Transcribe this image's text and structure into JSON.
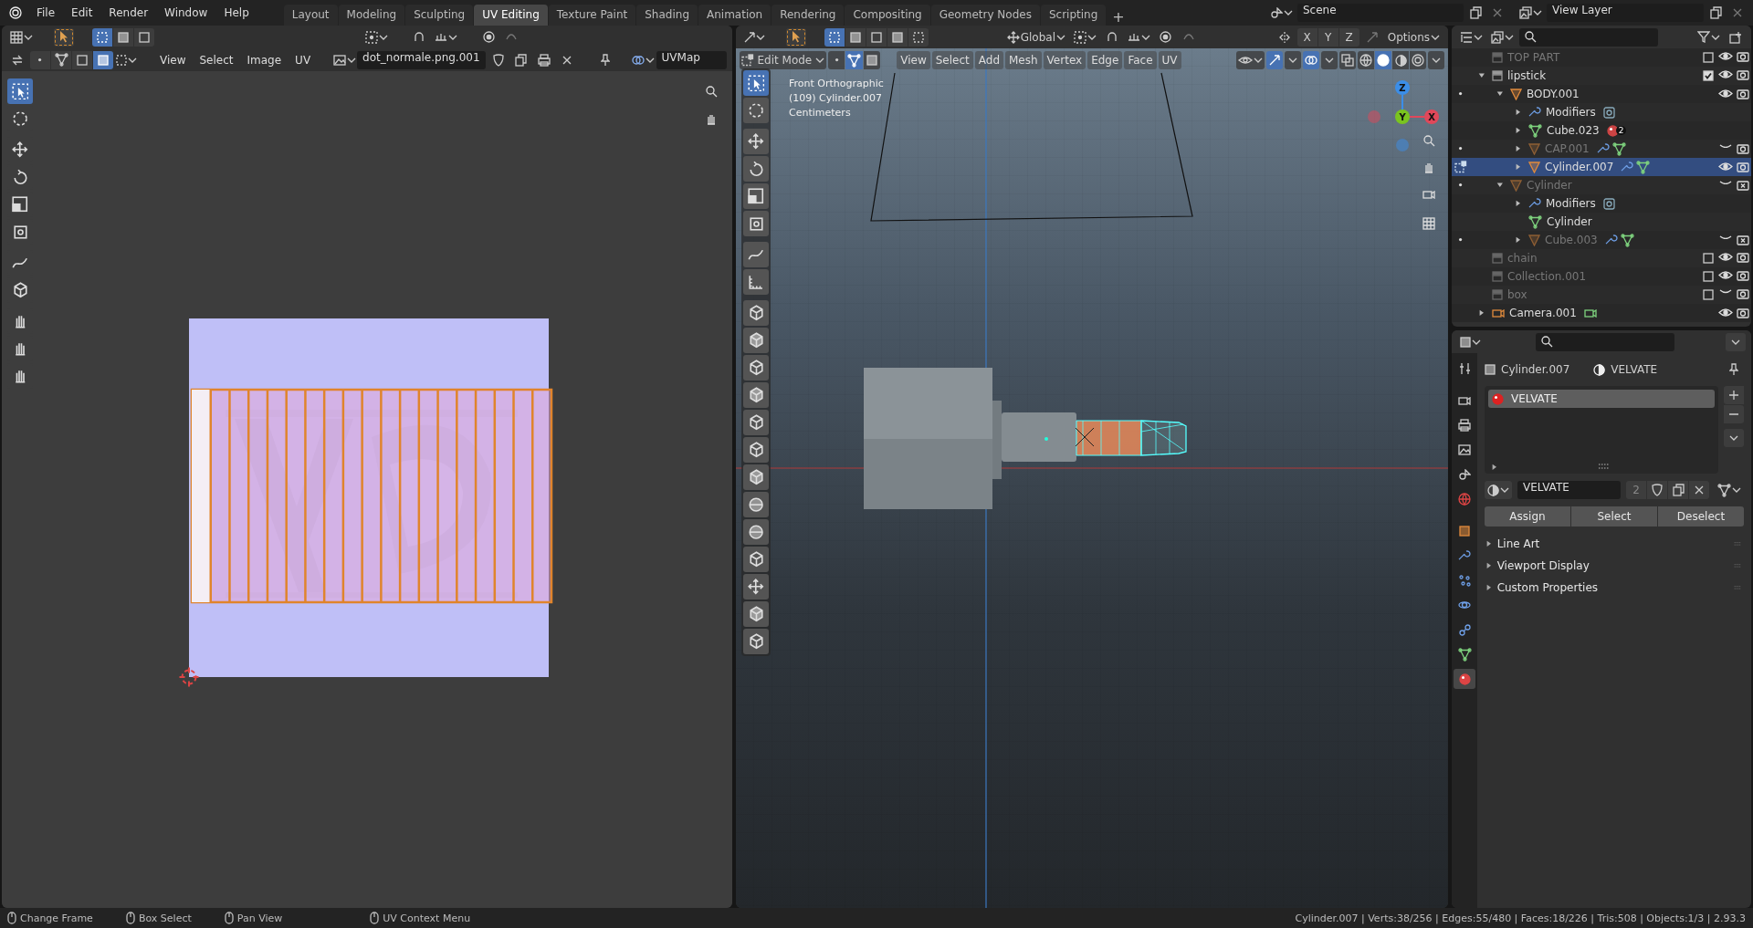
{
  "menu": [
    {
      "label": "File"
    },
    {
      "label": "Edit"
    },
    {
      "label": "Render"
    },
    {
      "label": "Window"
    },
    {
      "label": "Help"
    }
  ],
  "workspaces": [
    {
      "label": "Layout",
      "selected": false
    },
    {
      "label": "Modeling",
      "selected": false
    },
    {
      "label": "Sculpting",
      "selected": false
    },
    {
      "label": "UV Editing",
      "selected": true
    },
    {
      "label": "Texture Paint",
      "selected": false
    },
    {
      "label": "Shading",
      "selected": false
    },
    {
      "label": "Animation",
      "selected": false
    },
    {
      "label": "Rendering",
      "selected": false
    },
    {
      "label": "Compositing",
      "selected": false
    },
    {
      "label": "Geometry Nodes",
      "selected": false
    },
    {
      "label": "Scripting",
      "selected": false
    }
  ],
  "add_workspace": "+",
  "scene": "Scene",
  "view_layer": "View Layer",
  "uv_editor": {
    "tool_modes": [
      {
        "selected": true
      },
      {
        "selected": false
      },
      {
        "selected": false
      }
    ],
    "select_modes": [
      {
        "selected": false
      },
      {
        "selected": false
      },
      {
        "selected": false
      },
      {
        "selected": true
      }
    ],
    "menus": [
      "View",
      "Select",
      "Image",
      "UV"
    ],
    "image_name": "dot_normale.png.001",
    "uv_map": "UVMap",
    "tools": [
      {
        "selected": true
      },
      {
        "selected": false
      },
      {
        "selected": false
      },
      {
        "selected": false
      },
      {
        "selected": false
      },
      {
        "selected": false
      },
      {
        "selected": false
      },
      {
        "selected": false
      },
      {
        "selected": false
      },
      {
        "selected": false
      },
      {
        "selected": false
      }
    ]
  },
  "viewport": {
    "tool_modes": [
      {
        "selected": true
      },
      {
        "selected": false
      },
      {
        "selected": false
      },
      {
        "selected": false
      },
      {
        "selected": false
      }
    ],
    "orientation": "Global",
    "mirror_axes": [
      "X",
      "Y",
      "Z"
    ],
    "options": "Options",
    "mode": "Edit Mode",
    "select_modes": [
      {
        "selected": false
      },
      {
        "selected": true
      },
      {
        "selected": false
      }
    ],
    "menus": [
      "View",
      "Select",
      "Add",
      "Mesh",
      "Vertex",
      "Edge",
      "Face",
      "UV"
    ],
    "shading": [
      {
        "selected": false
      },
      {
        "selected": true
      },
      {
        "selected": false
      },
      {
        "selected": false
      }
    ],
    "overlay_text": [
      "Front Orthographic",
      "(109) Cylinder.007",
      "Centimeters"
    ],
    "gizmo_axes": [
      "Z",
      "Y",
      "X"
    ],
    "tools": [
      {
        "selected": true
      },
      {
        "selected": false
      },
      {
        "selected": false
      },
      {
        "selected": false
      },
      {
        "selected": false
      },
      {
        "selected": false
      },
      {
        "selected": false
      },
      {
        "selected": false
      },
      {
        "selected": false
      },
      {
        "selected": false
      },
      {
        "selected": false
      },
      {
        "selected": false
      },
      {
        "selected": false
      },
      {
        "selected": false
      },
      {
        "selected": false
      },
      {
        "selected": false
      },
      {
        "selected": false
      },
      {
        "selected": false
      },
      {
        "selected": false
      },
      {
        "selected": false
      },
      {
        "selected": false
      }
    ]
  },
  "outliner": {
    "items": [
      {
        "label": "TOP PART",
        "kind": "collection",
        "selected": false,
        "checked": false,
        "visible": true,
        "renderable": true
      },
      {
        "label": "lipstick",
        "kind": "collection",
        "selected": false,
        "expanded": true,
        "checked": true,
        "visible": true,
        "renderable": true,
        "children": [
          {
            "label": "BODY.001",
            "kind": "object",
            "selected": false,
            "expanded": true,
            "visible": true,
            "renderable": true,
            "children": [
              {
                "label": "Modifiers",
                "kind": "modifiers",
                "selected": false,
                "expanded": false
              },
              {
                "label": "Cube.023",
                "kind": "mesh_data",
                "selected": false,
                "expanded": false,
                "badge": "2"
              },
              {
                "label": "CAP.001",
                "kind": "object",
                "selected": false,
                "expanded": false,
                "visible": false,
                "renderable": true
              },
              {
                "label": "Cylinder.007",
                "kind": "object",
                "selected": true,
                "expanded": false,
                "visible": true,
                "renderable": true
              }
            ]
          },
          {
            "label": "Cylinder",
            "kind": "object",
            "selected": false,
            "expanded": true,
            "visible": false,
            "renderable": false,
            "children": [
              {
                "label": "Modifiers",
                "kind": "modifiers",
                "selected": false,
                "expanded": false
              },
              {
                "label": "Cylinder",
                "kind": "mesh_data",
                "selected": false
              },
              {
                "label": "Cube.003",
                "kind": "object",
                "selected": false,
                "expanded": false,
                "visible": false,
                "renderable": false
              }
            ]
          }
        ]
      },
      {
        "label": "chain",
        "kind": "collection",
        "selected": false,
        "checked": false,
        "visible": true,
        "renderable": true
      },
      {
        "label": "Collection.001",
        "kind": "collection",
        "selected": false,
        "checked": false,
        "visible": true,
        "renderable": true
      },
      {
        "label": "box",
        "kind": "collection",
        "selected": false,
        "checked": false,
        "visible": false,
        "renderable": true
      },
      {
        "label": "Camera.001",
        "kind": "camera",
        "selected": false,
        "expanded": false,
        "visible": true,
        "renderable": true
      }
    ]
  },
  "properties": {
    "tabs": [
      {
        "selected": false
      },
      {
        "selected": false
      },
      {
        "selected": false
      },
      {
        "selected": false
      },
      {
        "selected": false
      },
      {
        "selected": false
      },
      {
        "selected": false
      },
      {
        "selected": false
      },
      {
        "selected": false
      },
      {
        "selected": false
      },
      {
        "selected": false
      },
      {
        "selected": false
      },
      {
        "selected": true
      }
    ],
    "object": "Cylinder.007",
    "material": "VELVATE",
    "slots": [
      {
        "name": "VELVATE",
        "selected": true
      }
    ],
    "material_name": "VELVATE",
    "users": "2",
    "buttons": [
      "Assign",
      "Select",
      "Deselect"
    ],
    "panels": [
      {
        "label": "Line Art",
        "expanded": false
      },
      {
        "label": "Viewport Display",
        "expanded": false
      },
      {
        "label": "Custom Properties",
        "expanded": false
      }
    ]
  },
  "status_bar": {
    "hints": [
      "Change Frame",
      "Box Select",
      "Pan View",
      "UV Context Menu"
    ],
    "stats": "Cylinder.007 | Verts:38/256 | Edges:55/480 | Faces:18/226 | Tris:508 | Objects:1/3 | 2.93.3"
  }
}
